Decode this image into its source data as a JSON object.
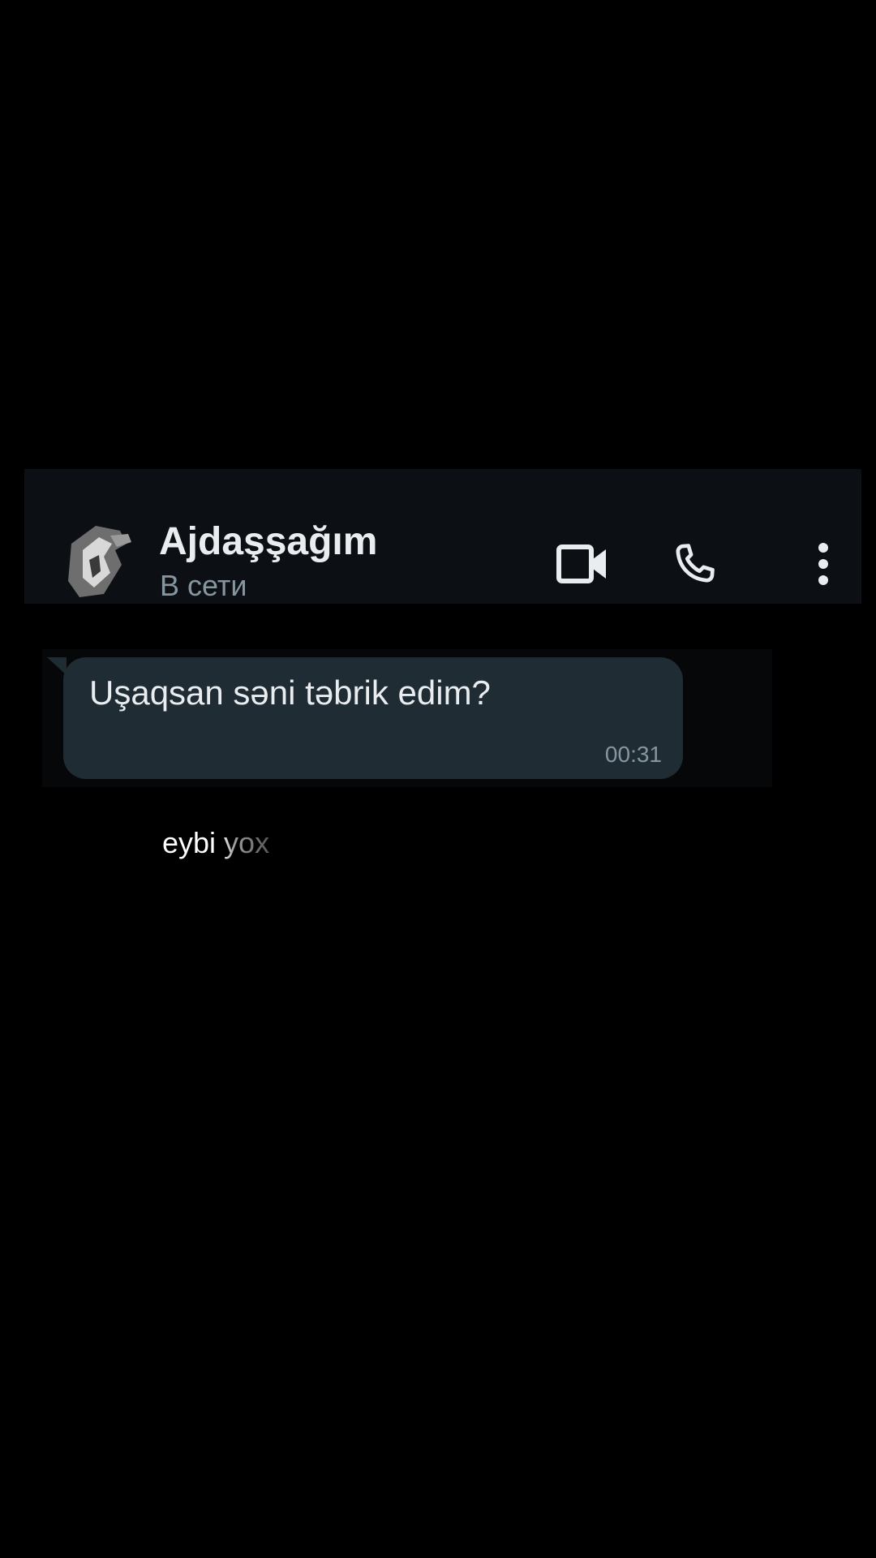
{
  "header": {
    "contact_name": "Ajdaşşağım",
    "status": "В сети",
    "icons": {
      "avatar": "avatar-image",
      "video": "video-camera-icon",
      "call": "phone-icon",
      "menu": "more-vert-icon"
    }
  },
  "messages": [
    {
      "text": "Uşaqsan səni təbrik edim?",
      "time": "00:31",
      "direction": "incoming"
    }
  ],
  "caption": {
    "text": "eybi yox"
  },
  "colors": {
    "background": "#000000",
    "header_bg": "#0c1014",
    "bubble_bg": "#1f2c34",
    "primary_text": "#e9edef",
    "secondary_text": "#8696a0"
  }
}
